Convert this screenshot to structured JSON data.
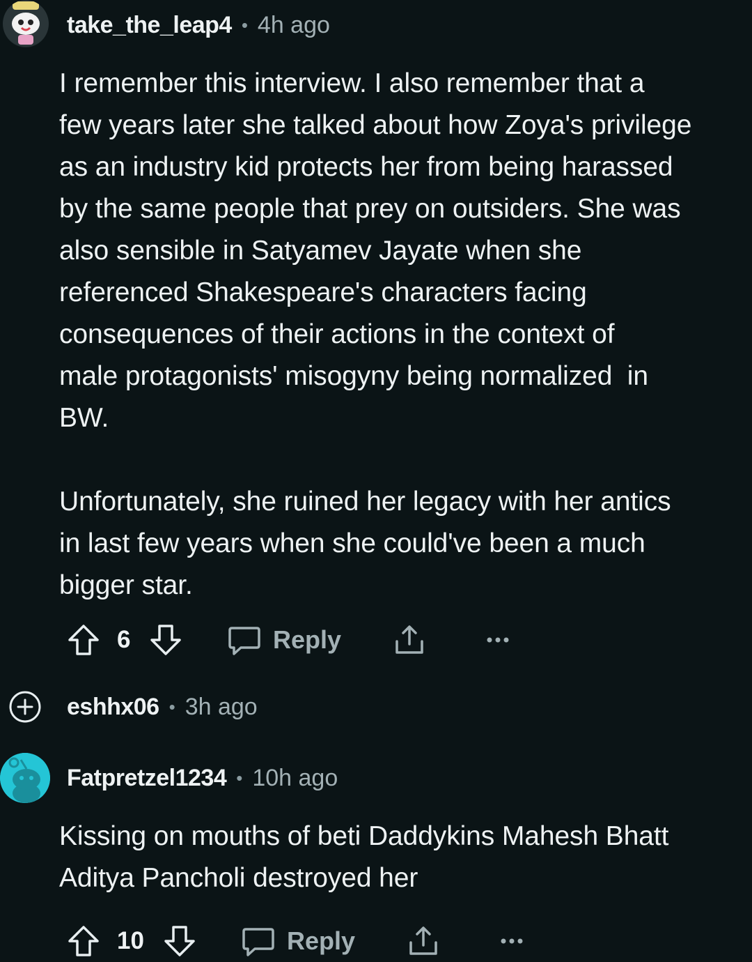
{
  "comments": [
    {
      "username": "take_the_leap4",
      "separator": "•",
      "time": "4h ago",
      "avatar_icon": "snoo-avatar-cool",
      "body": "I remember this interview. I also remember that a\nfew years later she talked about how Zoya's privilege\nas an industry kid protects her from being harassed\nby the same people that prey on outsiders. She was\nalso sensible in Satyamev Jayate when she\nreferenced Shakespeare's characters facing\nconsequences of their actions in the context of\nmale protagonists' misogyny being normalized  in\nBW.\n\nUnfortunately, she ruined her legacy with her antics\nin last few years when she could've been a much\nbigger star.",
      "votes": "6",
      "reply_label": "Reply"
    },
    {
      "username": "eshhx06",
      "separator": "•",
      "time": "3h ago",
      "collapsed": true,
      "expand_icon": "plus-circle-icon"
    },
    {
      "username": "Fatpretzel1234",
      "separator": "•",
      "time": "10h ago",
      "avatar_icon": "snoo-avatar-default",
      "avatar_color": "#24c5d6",
      "body": "Kissing on mouths of beti Daddykins Mahesh Bhatt\nAditya Pancholi destroyed her",
      "votes": "10",
      "reply_label": "Reply"
    }
  ],
  "colors": {
    "background": "#0b1416",
    "text": "#eef2f3",
    "muted": "#a3b1b5"
  }
}
